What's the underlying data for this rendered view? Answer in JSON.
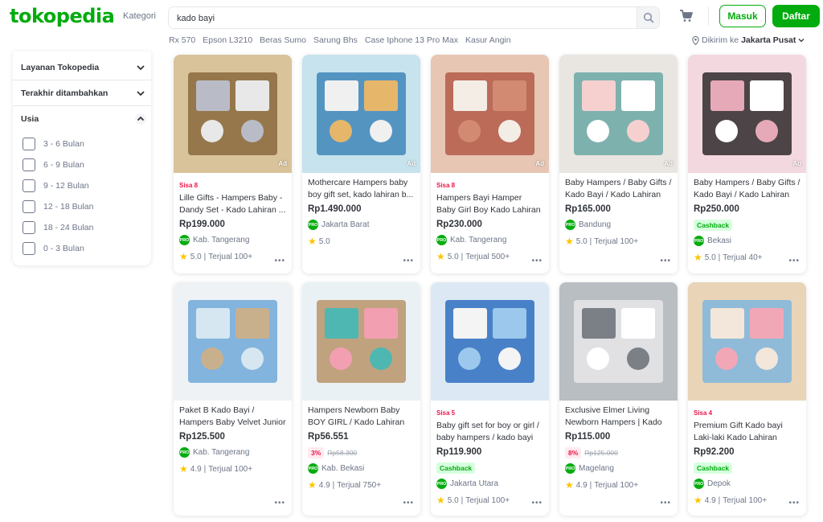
{
  "header": {
    "logo": "tokopedia",
    "kategori": "Kategori",
    "search_value": "kado bayi",
    "login": "Masuk",
    "register": "Daftar",
    "keywords": [
      "Rx 570",
      "Epson L3210",
      "Beras Sumo",
      "Sarung Bhs",
      "Case Iphone 13 Pro Max",
      "Kasur Angin"
    ],
    "location_prefix": "Dikirim ke",
    "location_city": "Jakarta Pusat"
  },
  "filter": {
    "sections": [
      {
        "label": "Layanan Tokopedia"
      },
      {
        "label": "Terakhir ditambahkan"
      },
      {
        "label": "Usia"
      }
    ],
    "age_options": [
      "3 - 6 Bulan",
      "6 - 9 Bulan",
      "9 - 12 Bulan",
      "12 - 18 Bulan",
      "18 - 24 Bulan",
      "0 - 3 Bulan"
    ]
  },
  "products": [
    {
      "sisa": "Sisa 8",
      "name": "Lille Gifts - Hampers Baby - Dandy Set - Kado Lahiran ...",
      "price": "Rp199.000",
      "location": "Kab. Tangerang",
      "rating": "5.0",
      "sold": "Terjual 100+",
      "ad": "Ad"
    },
    {
      "name": "Mothercare Hampers baby boy gift set, kado lahiran b...",
      "price": "Rp1.490.000",
      "location": "Jakarta Barat",
      "rating": "5.0",
      "ad": "Ad"
    },
    {
      "sisa": "Sisa 8",
      "name": "Hampers Bayi Hamper Baby Girl Boy Kado Lahiran Laki ...",
      "price": "Rp230.000",
      "location": "Kab. Tangerang",
      "rating": "5.0",
      "sold": "Terjual 500+",
      "ad": "Ad"
    },
    {
      "name": "Baby Hampers / Baby Gifts / Kado Bayi / Kado Lahiran -...",
      "price": "Rp165.000",
      "location": "Bandung",
      "rating": "5.0",
      "sold": "Terjual 100+",
      "ad": "Ad"
    },
    {
      "name": "Baby Hampers / Baby Gifts / Kado Bayi / Kado Lahiran -...",
      "price": "Rp250.000",
      "cashback": "Cashback",
      "location": "Bekasi",
      "rating": "5.0",
      "sold": "Terjual 40+",
      "ad": "Ad"
    },
    {
      "name": "Paket B Kado Bayi / Hampers Baby Velvet Junior",
      "price": "Rp125.500",
      "location": "Kab. Tangerang",
      "rating": "4.9",
      "sold": "Terjual 100+"
    },
    {
      "name": "Hampers Newborn Baby BOY GIRL / Kado Lahiran Bayi...",
      "price": "Rp56.551",
      "discount": "3%",
      "old_price": "Rp58.300",
      "location": "Kab. Bekasi",
      "rating": "4.9",
      "sold": "Terjual 750+"
    },
    {
      "sisa": "Sisa 5",
      "name": "Baby gift set for boy or girl / baby hampers / kado bayi",
      "price": "Rp119.900",
      "cashback": "Cashback",
      "location": "Jakarta Utara",
      "rating": "5.0",
      "sold": "Terjual 100+"
    },
    {
      "name": "Exclusive Elmer Living Newborn Hampers | Kado Lahir...",
      "price": "Rp115.000",
      "discount": "8%",
      "old_price": "Rp125.000",
      "location": "Magelang",
      "rating": "4.9",
      "sold": "Terjual 100+"
    },
    {
      "sisa": "Sisa 4",
      "name": "Premium Gift Kado bayi Laki-laki Kado Lahiran Hadiah ...",
      "price": "Rp92.200",
      "cashback": "Cashback",
      "location": "Depok",
      "rating": "4.9",
      "sold": "Terjual 100+"
    }
  ],
  "colors": {
    "brand": "#03ac0e",
    "danger": "#ef144a",
    "text": "#31353b",
    "muted": "#6d7588"
  }
}
